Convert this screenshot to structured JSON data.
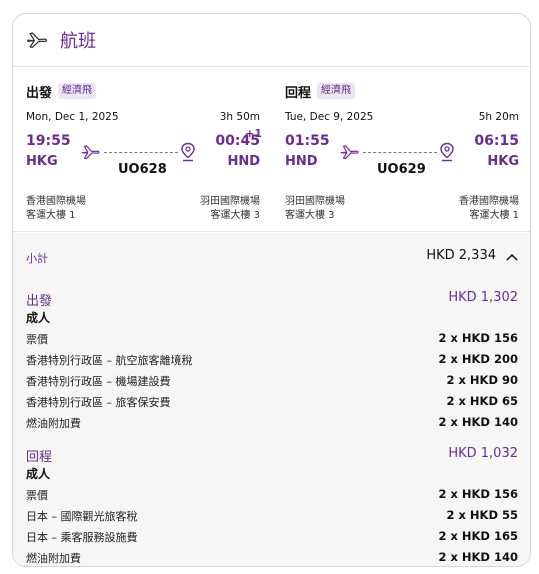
{
  "header": {
    "title": "航班",
    "icon": "airplane-icon"
  },
  "outbound": {
    "title": "出發",
    "badge": "經濟飛",
    "date": "Mon, Dec 1, 2025",
    "duration": "3h 50m",
    "dep_time": "19:55",
    "arr_time": "00:45",
    "plus_day": "+1",
    "dep_code": "HKG",
    "arr_code": "HND",
    "flight_no": "UO628",
    "dep_airport": "香港國際機場",
    "dep_terminal": "客運大樓 1",
    "arr_airport": "羽田國際機場",
    "arr_terminal": "客運大樓 3"
  },
  "return": {
    "title": "回程",
    "badge": "經濟飛",
    "date": "Tue, Dec 9, 2025",
    "duration": "5h 20m",
    "dep_time": "01:55",
    "arr_time": "06:15",
    "dep_code": "HND",
    "arr_code": "HKG",
    "flight_no": "UO629",
    "dep_airport": "羽田國際機場",
    "dep_terminal": "客運大樓 3",
    "arr_airport": "香港國際機場",
    "arr_terminal": "客運大樓 1"
  },
  "breakdown": {
    "subtotal_label": "小計",
    "subtotal_value": "HKD 2,334",
    "outbound": {
      "title": "出發",
      "total": "HKD 1,302",
      "pax": "成人",
      "lines": [
        {
          "label": "票價",
          "value": "2 x HKD 156"
        },
        {
          "label": "香港特別行政區 – 航空旅客離境稅",
          "value": "2 x HKD 200"
        },
        {
          "label": "香港特別行政區 – 機場建設費",
          "value": "2 x HKD 90"
        },
        {
          "label": "香港特別行政區 – 旅客保安費",
          "value": "2 x HKD 65"
        },
        {
          "label": "燃油附加費",
          "value": "2 x HKD 140"
        }
      ]
    },
    "return": {
      "title": "回程",
      "total": "HKD 1,032",
      "pax": "成人",
      "lines": [
        {
          "label": "票價",
          "value": "2 x HKD 156"
        },
        {
          "label": "日本 – 國際觀光旅客稅",
          "value": "2 x HKD 55"
        },
        {
          "label": "日本 – 乘客服務設施費",
          "value": "2 x HKD 165"
        },
        {
          "label": "燃油附加費",
          "value": "2 x HKD 140"
        }
      ]
    }
  },
  "colors": {
    "accent": "#6a2c91",
    "badge_bg": "#ede4f5",
    "breakdown_bg": "#f6f6f6"
  }
}
